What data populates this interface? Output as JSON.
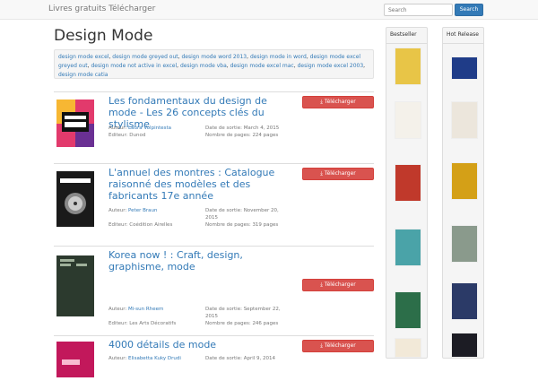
{
  "navbar": {
    "brand": "Livres gratuits Télécharger",
    "search_placeholder": "Search",
    "search_button": "Search"
  },
  "page": {
    "title": "Design Mode",
    "tags": [
      "design mode excel",
      "design mode greyed out",
      "design mode word 2013",
      "design mode in word",
      "design mode excel greyed out",
      "design mode not active in excel",
      "design mode vba",
      "design mode excel mac",
      "design mode excel 2003",
      "design mode catia"
    ]
  },
  "download_label": "Télécharger",
  "labels": {
    "author": "Auteur:",
    "publisher": "Editeur:",
    "date": "Date de sortie:",
    "pages": "Nombre de pages:"
  },
  "books": [
    {
      "title": "Les fondamentaux du design de mode - Les 26 concepts clés du stylisme",
      "author": "Laura Volpintesta",
      "publisher": "Dunod",
      "date": "March 4, 2015",
      "pages": "224 pages",
      "cover_color": "#e23a6c"
    },
    {
      "title": "L'annuel des montres : Catalogue raisonné des modèles et des fabricants 17e année",
      "author": "Peter Braun",
      "publisher": "Coédition Airelles",
      "date": "November 20, 2015",
      "pages": "319 pages",
      "cover_color": "#1a1a1a"
    },
    {
      "title": "Korea now ! : Craft, design, graphisme, mode",
      "author": "Mi-sun Rheem",
      "publisher": "Les Arts Décoratifs",
      "date": "September 22, 2015",
      "pages": "246 pages",
      "cover_color": "#2c3a2e"
    },
    {
      "title": "4000 détails de mode",
      "author": "Elisabetta Kuky Drudi",
      "publisher": "",
      "date": "April 9, 2014",
      "pages": "",
      "cover_color": "#c2185b"
    }
  ],
  "sidebar_bestseller": {
    "title": "Bestseller",
    "covers": [
      "#e8c547",
      "#f4f1ea",
      "#c0392b",
      "#4aa3a8",
      "#2c6e49",
      "#f2e9d8"
    ]
  },
  "sidebar_hot": {
    "title": "Hot Release",
    "covers": [
      "#1f3c88",
      "#ece6dc",
      "#d4a017",
      "#8a9a8c",
      "#2b3a67",
      "#1c1c24"
    ]
  }
}
